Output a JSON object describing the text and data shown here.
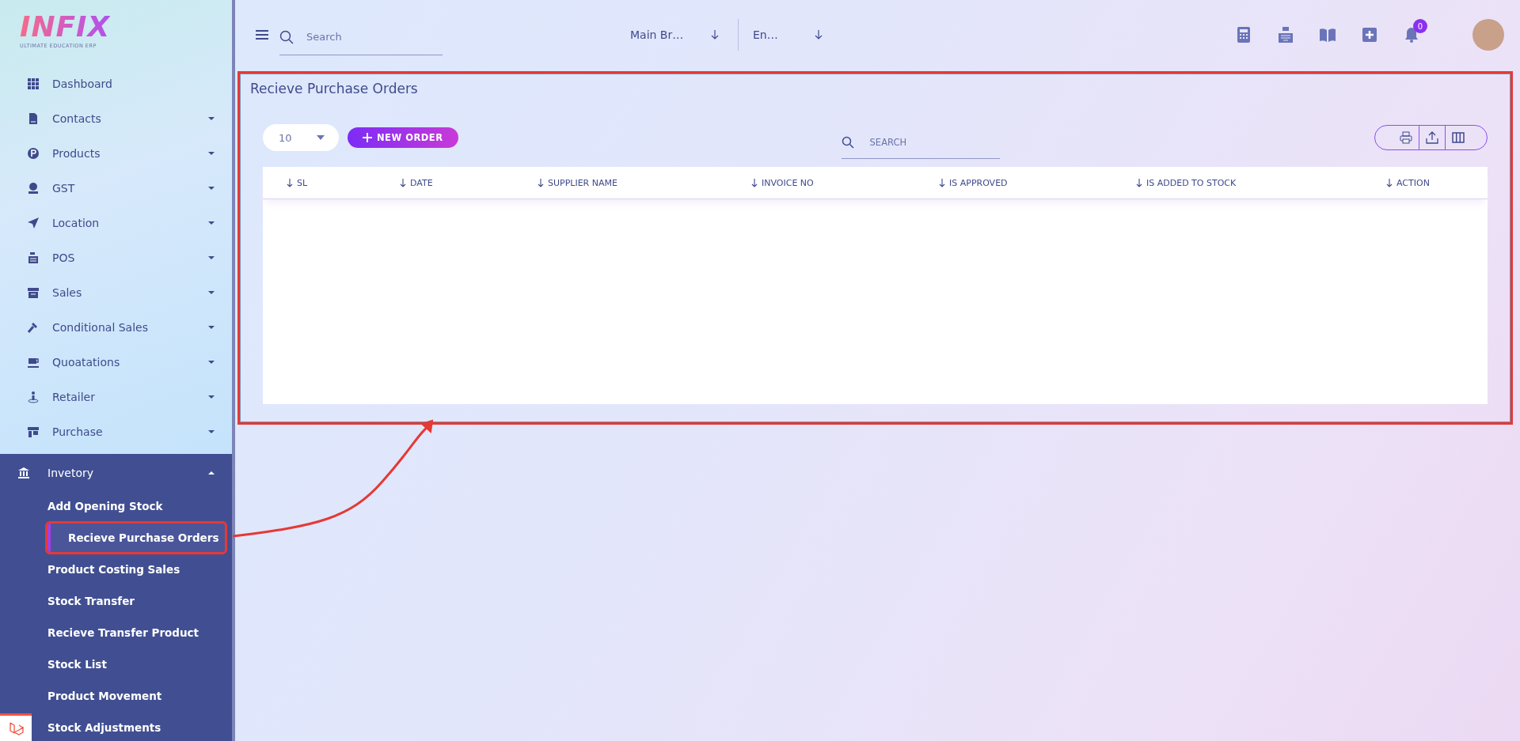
{
  "brand": {
    "logo": "INFIX",
    "tagline": "ULTIMATE EDUCATION ERP"
  },
  "sidebar": {
    "items": [
      {
        "label": "Dashboard",
        "has_submenu": false,
        "expanded": false
      },
      {
        "label": "Contacts",
        "has_submenu": true,
        "expanded": false
      },
      {
        "label": "Products",
        "has_submenu": true,
        "expanded": false
      },
      {
        "label": "GST",
        "has_submenu": true,
        "expanded": false
      },
      {
        "label": "Location",
        "has_submenu": true,
        "expanded": false
      },
      {
        "label": "POS",
        "has_submenu": true,
        "expanded": false
      },
      {
        "label": "Sales",
        "has_submenu": true,
        "expanded": false
      },
      {
        "label": "Conditional Sales",
        "has_submenu": true,
        "expanded": false
      },
      {
        "label": "Quoatations",
        "has_submenu": true,
        "expanded": false
      },
      {
        "label": "Retailer",
        "has_submenu": true,
        "expanded": false
      },
      {
        "label": "Purchase",
        "has_submenu": true,
        "expanded": false
      },
      {
        "label": "Invetory",
        "has_submenu": true,
        "expanded": true,
        "children": [
          {
            "label": "Add Opening Stock",
            "selected": false
          },
          {
            "label": "Recieve Purchase Orders",
            "selected": true
          },
          {
            "label": "Product Costing Sales",
            "selected": false
          },
          {
            "label": "Stock Transfer",
            "selected": false
          },
          {
            "label": "Recieve Transfer Product",
            "selected": false
          },
          {
            "label": "Stock List",
            "selected": false
          },
          {
            "label": "Product Movement",
            "selected": false
          },
          {
            "label": "Stock Adjustments",
            "selected": false
          }
        ]
      }
    ]
  },
  "topbar": {
    "search": {
      "placeholder": "Search"
    },
    "branch": "Main Br…",
    "language": "En…",
    "notifications": "0"
  },
  "page": {
    "title": "Recieve Purchase Orders",
    "page_size": "10",
    "new_button": "NEW ORDER",
    "search": {
      "placeholder": "SEARCH"
    },
    "table": {
      "columns": [
        "SL",
        "DATE",
        "SUPPLIER NAME",
        "INVOICE NO",
        "IS APPROVED",
        "IS ADDED TO STOCK",
        "ACTION"
      ]
    }
  }
}
